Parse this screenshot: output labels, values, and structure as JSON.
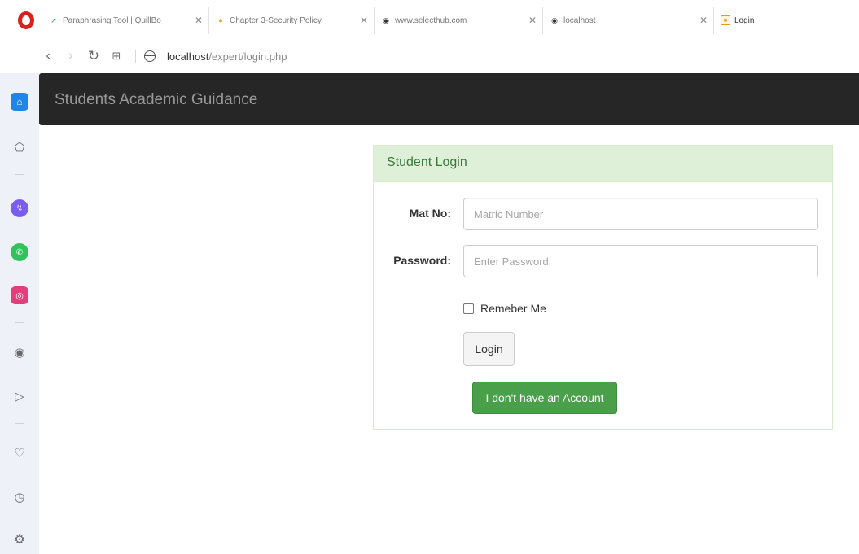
{
  "tabs": [
    {
      "title": "Paraphrasing Tool | QuillBo",
      "icon": "quillbot-icon"
    },
    {
      "title": "Chapter 3-Security Policy",
      "icon": "chapter-doc-icon"
    },
    {
      "title": "www.selecthub.com",
      "icon": "globe-icon"
    },
    {
      "title": "localhost",
      "icon": "globe-icon"
    },
    {
      "title": "Login",
      "icon": "login-favicon"
    }
  ],
  "addressbar": {
    "host": "localhost",
    "path": "/expert/login.php"
  },
  "navbar": {
    "brand": "Students Academic Guidance"
  },
  "login_panel": {
    "heading": "Student Login",
    "mat_no_label": "Mat No:",
    "mat_no_placeholder": "Matric Number",
    "password_label": "Password:",
    "password_placeholder": "Enter Password",
    "remember_label": "Remeber Me",
    "login_button": "Login",
    "no_account_button": "I don't have an Account"
  },
  "colors": {
    "navbar_bg": "#262626",
    "panel_heading_bg": "#dff0d8",
    "panel_heading_text": "#3c763d",
    "success_button": "#4aa04a",
    "opera_red": "#d9221c"
  }
}
